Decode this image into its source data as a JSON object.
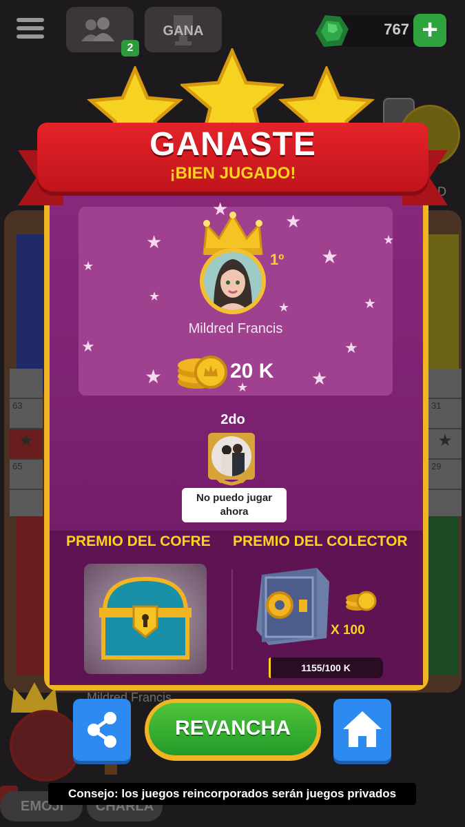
{
  "topbar": {
    "friends_badge": "2",
    "gana_label": "GANA",
    "gem_count": "767",
    "add_label": "+"
  },
  "background": {
    "opponent_name_fragment": "n D",
    "player_name": "Mildred Francis",
    "track_left": [
      "63",
      "65"
    ],
    "track_right": [
      "31",
      "29"
    ],
    "emoji_label": "EMOJI",
    "chat_label": "CHARLA"
  },
  "result": {
    "title": "GANASTE",
    "subtitle": "¡BIEN JUGADO!",
    "winner": {
      "place": "1º",
      "name": "Mildred Francis",
      "coins": "20 K"
    },
    "second": {
      "place": "2do",
      "message_line1": "No puedo jugar",
      "message_line2": "ahora"
    },
    "rewards": {
      "chest_title": "PREMIO DEL COFRE",
      "collector_title": "PREMIO DEL COLECTOR",
      "multiplier": "X 100",
      "progress_label": "1155/100 K",
      "progress_fraction": 0.01155
    }
  },
  "actions": {
    "rematch_label": "REVANCHA"
  },
  "tip": "Consejo: los juegos reincorporados serán juegos privados",
  "colors": {
    "panel_purple": "#7a1f6e",
    "ribbon_red": "#e5232a",
    "gold": "#f1b423",
    "accent_yellow": "#ffd21f",
    "rematch_green": "#2ea33e",
    "action_blue": "#2d8af0"
  },
  "icons": [
    "menu-icon",
    "friends-icon",
    "trophy-icon",
    "emerald-icon",
    "plus-icon",
    "crown-icon",
    "coin-icon",
    "chest-icon",
    "vault-icon",
    "share-icon",
    "home-icon",
    "star-icon",
    "laurel-icon"
  ]
}
